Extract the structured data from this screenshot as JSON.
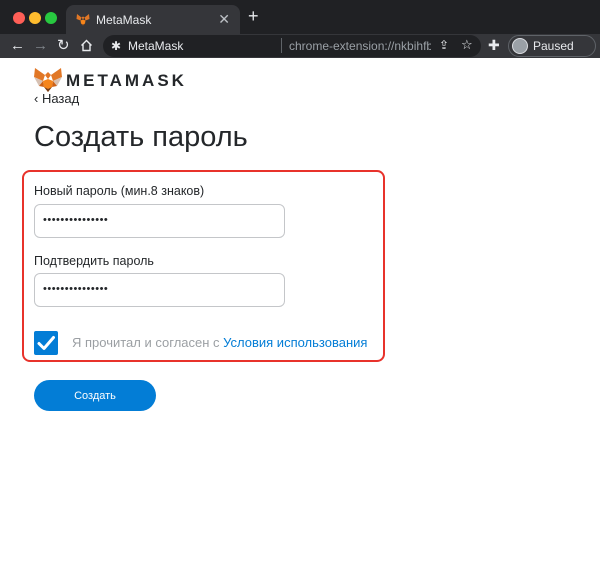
{
  "browser": {
    "tab_title": "MetaMask",
    "tab_close": "✕",
    "new_tab": "+",
    "site_name": "MetaMask",
    "url": "chrome-extension://nkbihfbeogaeaoehlefnkodbefgpgknn/home.html",
    "profile_status": "Paused"
  },
  "header": {
    "wordmark": "METAMASK",
    "back_link": "‹ Назад"
  },
  "main": {
    "title": "Создать пароль",
    "new_password": {
      "label": "Новый пароль (мин.8 знаков)",
      "value": "•••••••••••••••"
    },
    "confirm_password": {
      "label": "Подтвердить пароль",
      "value": "•••••••••••••••"
    },
    "terms": {
      "checked": true,
      "text": "Я прочитал и согласен с ",
      "link": "Условия использования"
    },
    "create_button": "Создать"
  },
  "colors": {
    "accent": "#037dd6",
    "highlight": "#e8322b",
    "browser_frame": "#202124"
  }
}
